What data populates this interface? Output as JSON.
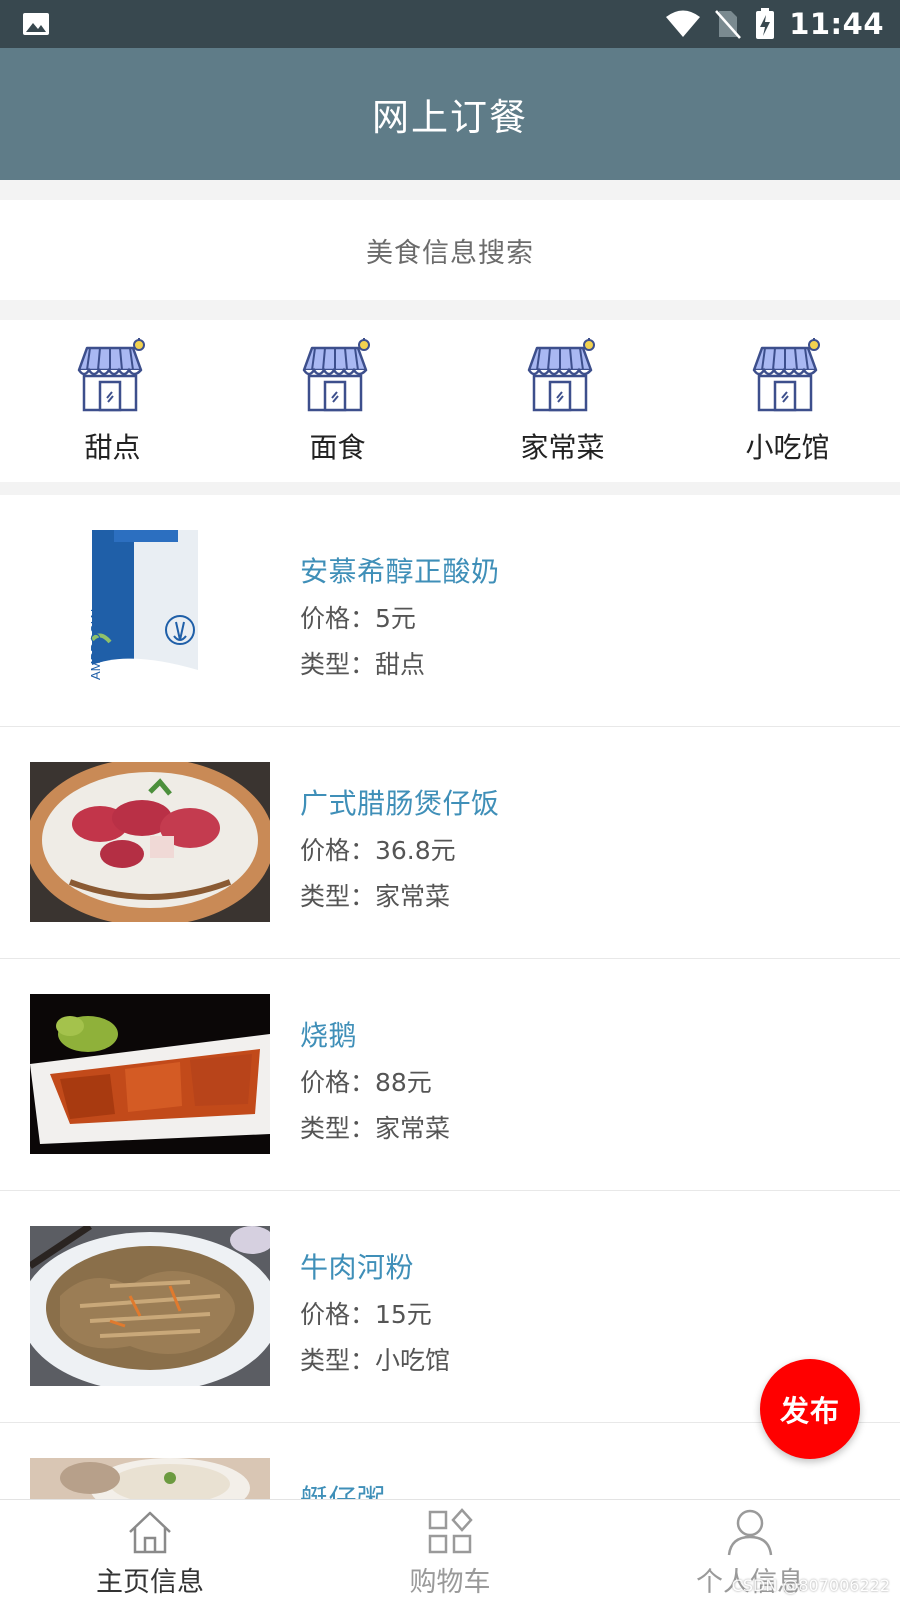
{
  "status_bar": {
    "time": "11:44",
    "icons": [
      "image-icon",
      "wifi-icon",
      "no-sim-icon",
      "battery-charging-icon"
    ]
  },
  "app_bar": {
    "title": "网上订餐"
  },
  "search": {
    "label": "美食信息搜索"
  },
  "categories": [
    {
      "label": "甜点",
      "icon": "store-icon"
    },
    {
      "label": "面食",
      "icon": "store-icon"
    },
    {
      "label": "家常菜",
      "icon": "store-icon"
    },
    {
      "label": "小吃馆",
      "icon": "store-icon"
    }
  ],
  "foods": [
    {
      "name": "安慕希醇正酸奶",
      "price": "价格：5元",
      "type": "类型：甜点"
    },
    {
      "name": "广式腊肠煲仔饭",
      "price": "价格：36.8元",
      "type": "类型：家常菜"
    },
    {
      "name": "烧鹅",
      "price": "价格：88元",
      "type": "类型：家常菜"
    },
    {
      "name": "牛肉河粉",
      "price": "价格：15元",
      "type": "类型：小吃馆"
    },
    {
      "name": "艇仔粥",
      "price": "",
      "type": ""
    }
  ],
  "fab": {
    "label": "发布"
  },
  "bottom_nav": [
    {
      "label": "主页信息",
      "icon": "home-icon",
      "active": true
    },
    {
      "label": "购物车",
      "icon": "grid-icon",
      "active": false
    },
    {
      "label": "个人信息",
      "icon": "user-icon",
      "active": false
    }
  ],
  "watermark": "CSDN @807006222",
  "colors": {
    "status_bar": "#38484f",
    "app_bar": "#5f7c88",
    "food_name": "#3f8fb8",
    "fab": "#ff0000"
  }
}
